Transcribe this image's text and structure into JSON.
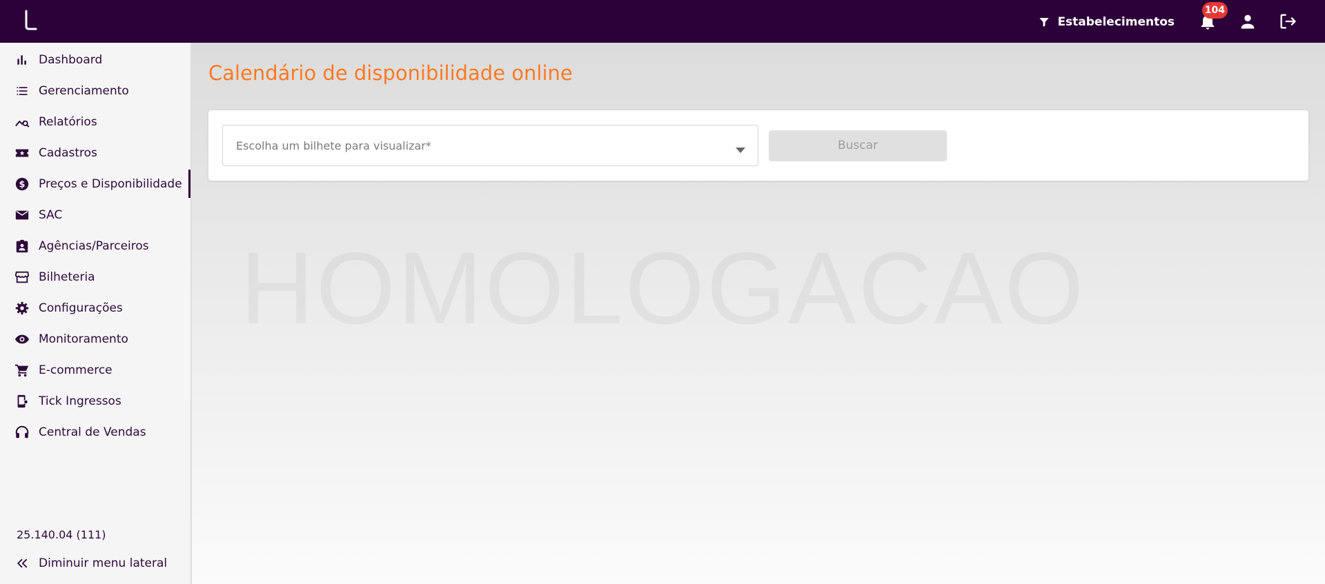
{
  "header": {
    "filter_label": "Estabelecimentos",
    "notification_count": "104",
    "icons": [
      "app-logo",
      "filter-icon",
      "bell-icon",
      "user-icon",
      "logout-icon"
    ]
  },
  "sidebar": {
    "items": [
      {
        "label": "Dashboard",
        "icon": "bar-chart-icon"
      },
      {
        "label": "Gerenciamento",
        "icon": "list-icon"
      },
      {
        "label": "Relatórios",
        "icon": "chart-search-icon"
      },
      {
        "label": "Cadastros",
        "icon": "star-ticket-icon"
      },
      {
        "label": "Preços e Disponibilidade",
        "icon": "dollar-circle-icon"
      },
      {
        "label": "SAC",
        "icon": "mail-icon"
      },
      {
        "label": "Agências/Parceiros",
        "icon": "contact-badge-icon"
      },
      {
        "label": "Bilheteria",
        "icon": "store-icon"
      },
      {
        "label": "Configurações",
        "icon": "gear-icon"
      },
      {
        "label": "Monitoramento",
        "icon": "eye-icon"
      },
      {
        "label": "E-commerce",
        "icon": "cart-icon"
      },
      {
        "label": "Tick Ingressos",
        "icon": "tablet-icon"
      },
      {
        "label": "Central de Vendas",
        "icon": "headset-icon"
      }
    ],
    "active_item": "Preços e Disponibilidade",
    "version": "25.140.04 (111)",
    "collapse_label": "Diminuir menu lateral"
  },
  "main": {
    "title": "Calendário de disponibilidade online",
    "watermark": "HOMOLOGACAO",
    "select_placeholder": "Escolha um bilhete para visualizar*",
    "search_button": "Buscar"
  },
  "colors": {
    "topbar": "#2c0038",
    "accent_title": "#ff7a22",
    "badge": "#e53935",
    "sidebar_text": "#2d0a3a"
  }
}
